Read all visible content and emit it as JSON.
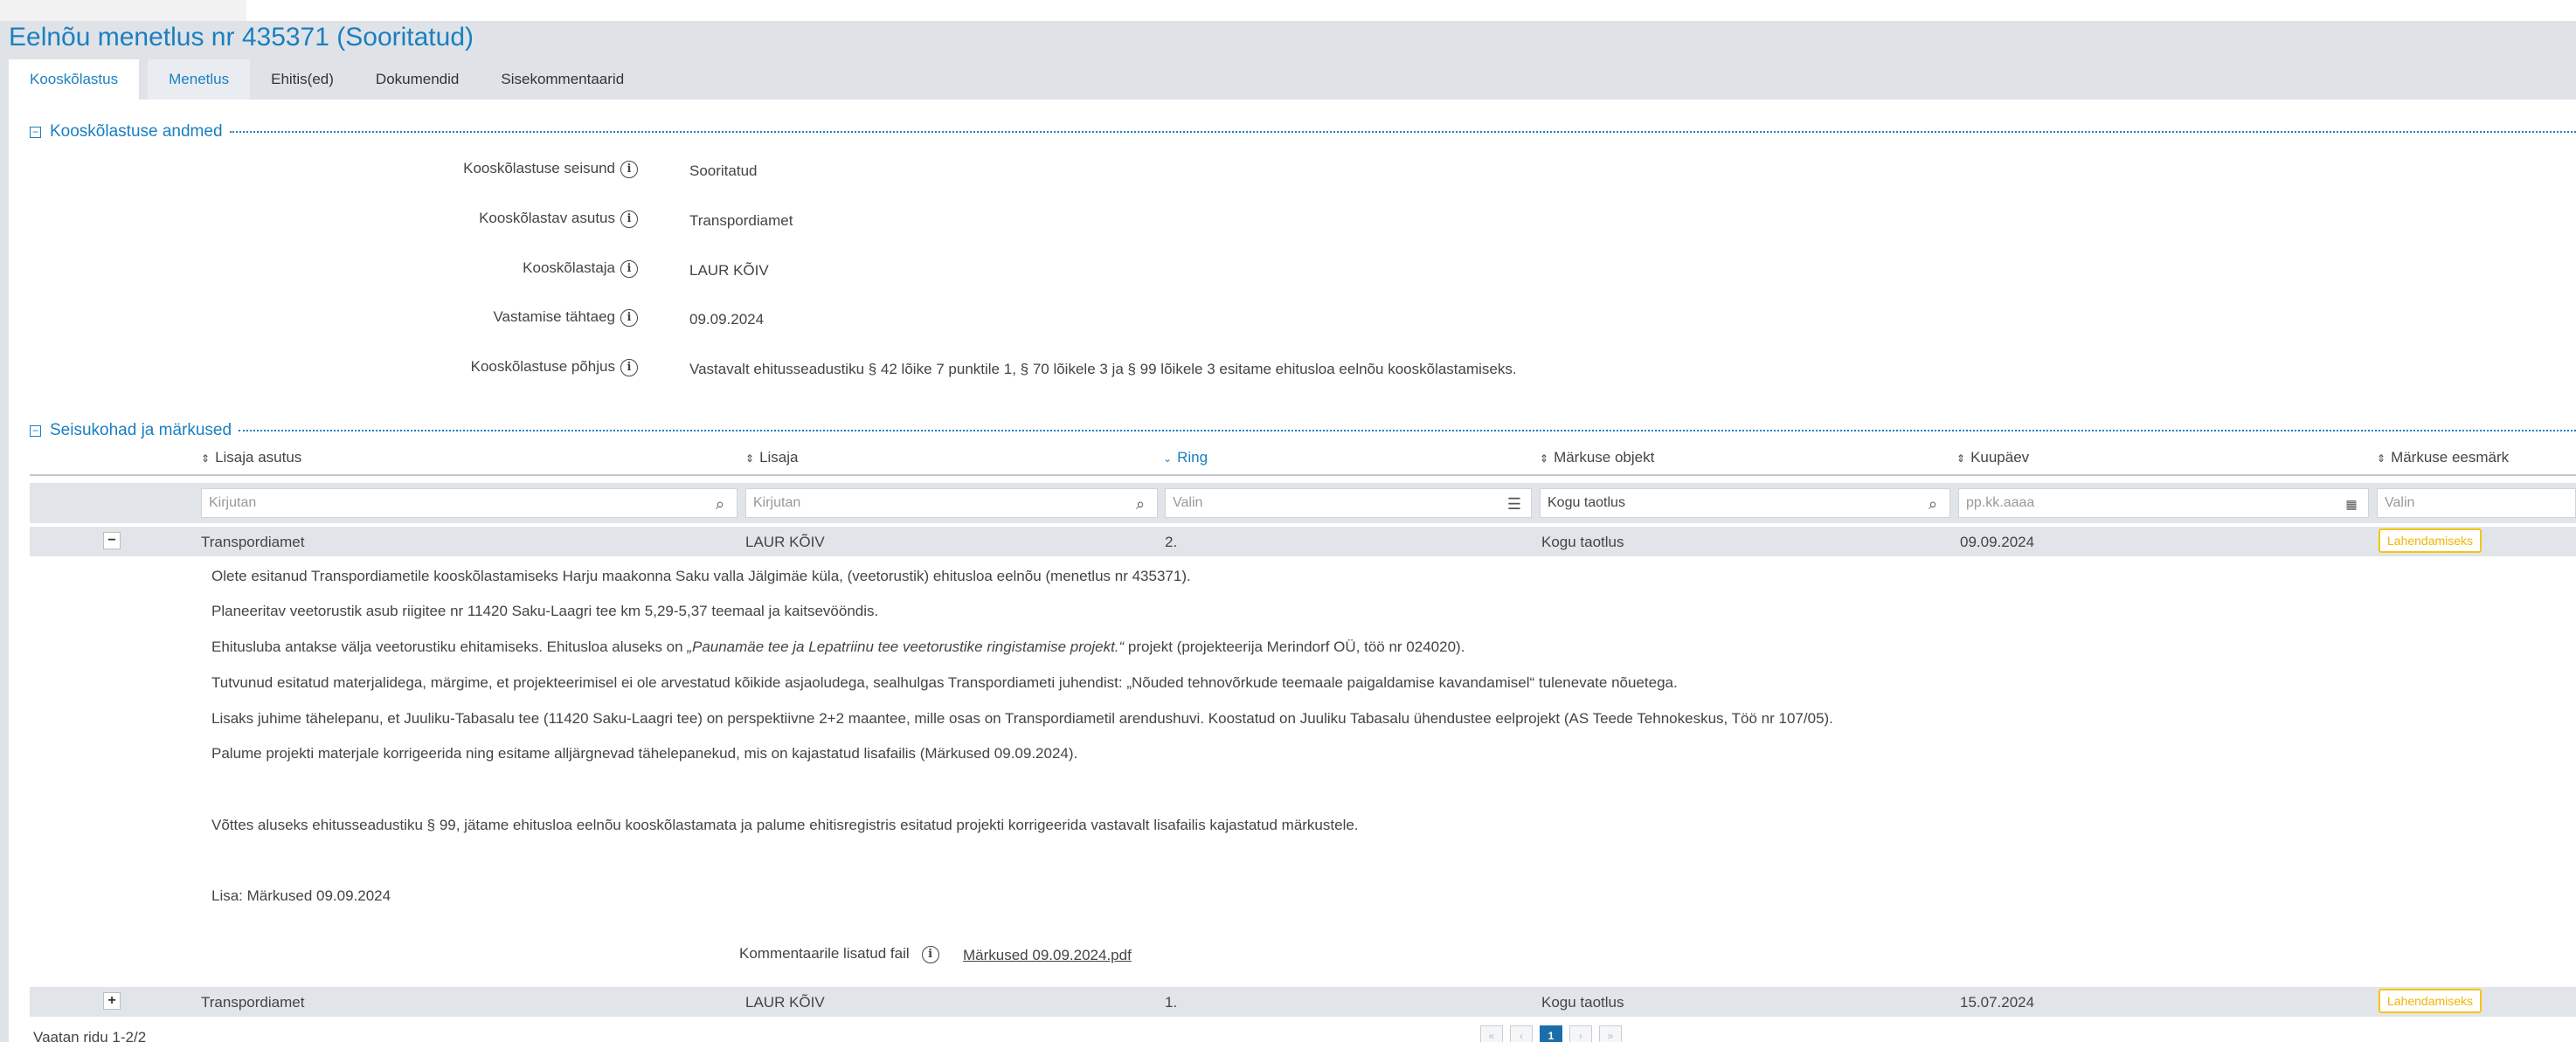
{
  "title": "Eelnõu menetlus nr 435371 (Sooritatud)",
  "tabs": [
    {
      "label": "Kooskõlastus"
    },
    {
      "label": "Menetlus"
    },
    {
      "label": "Ehitis(ed)"
    },
    {
      "label": "Dokumendid"
    },
    {
      "label": "Sisekommentaarid"
    }
  ],
  "section1": {
    "title": "Kooskõlastuse andmed",
    "collapse": "−",
    "fields": [
      {
        "label": "Kooskõlastuse seisund",
        "value": "Sooritatud"
      },
      {
        "label": "Kooskõlastav asutus",
        "value": "Transpordiamet"
      },
      {
        "label": "Kooskõlastaja",
        "value": "LAUR KÕIV"
      },
      {
        "label": "Vastamise tähtaeg",
        "value": "09.09.2024"
      },
      {
        "label": "Kooskõlastuse põhjus",
        "value": "Vastavalt ehitusseadustiku § 42 lõike 7 punktile 1, § 70 lõikele 3 ja § 99 lõikele 3 esitame ehitusloa eelnõu kooskõlastamiseks."
      }
    ]
  },
  "section2": {
    "title": "Seisukohad ja märkused",
    "collapse": "−",
    "columns": [
      {
        "label": "Lisaja asutus"
      },
      {
        "label": "Lisaja"
      },
      {
        "label": "Ring"
      },
      {
        "label": "Märkuse objekt"
      },
      {
        "label": "Kuupäev"
      },
      {
        "label": "Märkuse eesmärk"
      }
    ],
    "filters": [
      {
        "placeholder": "Kirjutan"
      },
      {
        "placeholder": "Kirjutan"
      },
      {
        "placeholder": "Valin"
      },
      {
        "value": "Kogu taotlus"
      },
      {
        "placeholder": "pp.kk.aaaa"
      },
      {
        "placeholder": "Valin"
      }
    ],
    "rows": [
      {
        "toggle": "−",
        "asutus": "Transpordiamet",
        "lisaja": "LAUR KÕIV",
        "ring": "2.",
        "objekt": "Kogu taotlus",
        "kuupaev": "09.09.2024",
        "eesmark": "Lahendamiseks",
        "comment": {
          "p1": "Olete esitanud Transpordiametile kooskõlastamiseks Harju maakonna Saku valla Jälgimäe küla, (veetorustik) ehitusloa eelnõu (menetlus nr 435371).",
          "p2": "Planeeritav veetorustik asub riigitee nr 11420 Saku-Laagri tee km 5,29-5,37 teemaal ja kaitsevööndis.",
          "p3_before": "Ehitusluba antakse välja veetorustiku ehitamiseks. Ehitusloa aluseks on ",
          "p3_italic": "„Paunamäe tee ja Lepatriinu tee veetorustike ringistamise projekt.“",
          "p3_after": " projekt (projekteerija Merindorf OÜ, töö nr 024020).",
          "p4": "Tutvunud esitatud materjalidega, märgime, et projekteerimisel ei ole arvestatud kõikide asjaoludega, sealhulgas Transpordiameti juhendist: „Nõuded tehnovõrkude teemaale paigaldamise kavandamisel“ tulenevate nõuetega.",
          "p5": "Lisaks juhime tähelepanu, et Juuliku-Tabasalu tee (11420 Saku-Laagri tee) on perspektiivne 2+2 maantee, mille osas on Transpordiametil arendushuvi. Koostatud on Juuliku Tabasalu ühendustee eelprojekt (AS Teede Tehnokeskus, Töö nr 107/05).",
          "p6": "Palume projekti materjale korrigeerida ning esitame alljärgnevad tähelepanekud, mis on kajastatud lisafailis (Märkused 09.09.2024).",
          "p7": "Võttes aluseks ehitusseadustiku § 99, jätame ehitusloa eelnõu kooskõlastamata ja palume ehitisregistris esitatud projekti korrigeerida vastavalt lisafailis kajastatud märkustele.",
          "p8": "Lisa: Märkused 09.09.2024"
        },
        "attachment_label": "Kommentaarile lisatud fail",
        "attachment_file": "Märkused 09.09.2024.pdf"
      },
      {
        "toggle": "+",
        "asutus": "Transpordiamet",
        "lisaja": "LAUR KÕIV",
        "ring": "1.",
        "objekt": "Kogu taotlus",
        "kuupaev": "15.07.2024",
        "eesmark": "Lahendamiseks"
      }
    ],
    "footer": "Vaatan ridu 1-2/2",
    "pager": {
      "first": "«",
      "prev": "‹",
      "current": "1",
      "next": "›",
      "last": "»"
    }
  },
  "icons": {
    "info": "info-circle-icon",
    "search": "search-icon",
    "list": "list-icon",
    "calendar": "calendar-icon",
    "sort": "sort-arrows-icon"
  },
  "colors": {
    "accent": "#1a7fc0",
    "header_bg": "#dfe3e8",
    "badge": "#f5c518"
  }
}
